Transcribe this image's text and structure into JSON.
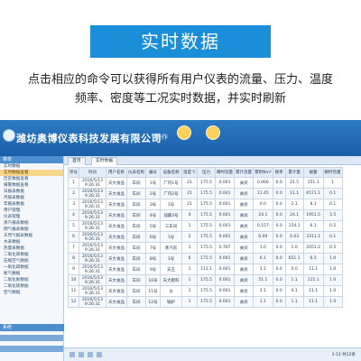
{
  "banner": {
    "title": "实时数据"
  },
  "description": {
    "line1": "点击相应的命令可以获得所有用户仪表的流量、压力、温度",
    "line2": "频率、密度等工况实时数据，并实时刷新"
  },
  "app": {
    "company": "潍坊奥博仪表科技发展有限公司",
    "header_label": "操作"
  },
  "sidebar": {
    "title": "菜单",
    "items": [
      {
        "label": "实时数据",
        "selected": false
      },
      {
        "label": "实时数据查看",
        "selected": true
      },
      {
        "label": "历史数据查看",
        "selected": false
      },
      {
        "label": "报警数据查看",
        "selected": false
      },
      {
        "label": "日报表数据",
        "selected": false
      },
      {
        "label": "月报表数据",
        "selected": false
      },
      {
        "label": "年报表数据",
        "selected": false
      },
      {
        "label": "用户管理",
        "selected": false
      },
      {
        "label": "仪表管理",
        "selected": false
      },
      {
        "label": "蒸汽报表数据",
        "selected": false
      },
      {
        "label": "燃气报表数据",
        "selected": false
      },
      {
        "label": "天然气报表数据",
        "selected": false
      },
      {
        "label": "水表数据",
        "selected": false
      },
      {
        "label": "热量表数据",
        "selected": false
      },
      {
        "label": "二氧化碳数据",
        "selected": false
      },
      {
        "label": "压缩空气数据",
        "selected": false
      },
      {
        "label": "一氧化碳数据",
        "selected": false
      },
      {
        "label": "氮气数据",
        "selected": false
      },
      {
        "label": "二氧化氮数据",
        "selected": false
      },
      {
        "label": "二氧化硫数据",
        "selected": false
      },
      {
        "label": "空气数据",
        "selected": false
      }
    ],
    "footer": "系统"
  },
  "tabs": [
    {
      "label": "首页"
    },
    {
      "label": "实时数据"
    }
  ],
  "table": {
    "headers": [
      "序号",
      "时间",
      "用户名称",
      "仪表名称",
      "编号",
      "设备名称",
      "温度℃",
      "压力",
      "瞬时流量",
      "累计流量",
      "累积Nm³",
      "频率",
      "累计量",
      "报警",
      "瞬时热量",
      "瞬时热量"
    ],
    "rows": [
      [
        "1",
        "2016/5/13 9:26:31",
        "天大食品",
        "车间",
        "1号",
        "厂内1号",
        "21",
        "175.5",
        "0.001",
        "关闭",
        "0.066",
        "0.0",
        "21.5",
        "151.1",
        "1"
      ],
      [
        "2",
        "2016/5/13 9:26:31",
        "天大食品",
        "车间",
        "2号",
        "厂内2号",
        "21",
        "175.5",
        "0.001",
        "关闭",
        "11.45",
        "0.0",
        "11.1",
        "6571.1",
        "0.1"
      ],
      [
        "3",
        "2016/5/13 9:26:31",
        "天大食品",
        "车间",
        "3号",
        "1号",
        "21",
        "175.5",
        "0.001",
        "关闭",
        "0.0",
        "0.0",
        "2.1",
        "8.1",
        "0.1"
      ],
      [
        "4",
        "2016/5/13 9:26:31",
        "天大食品",
        "车间",
        "4号",
        "加藤3号",
        "4",
        "175.5",
        "0.001",
        "关闭",
        "24.1",
        "0.0",
        "24.1",
        "1951.5",
        "3.5"
      ],
      [
        "5",
        "2016/5/13 9:26:31",
        "天大食品",
        "车间",
        "5号",
        "三车间",
        "1",
        "175.5",
        "0.001",
        "关闭",
        "0.157",
        "0.0",
        "154.1",
        "6.1",
        "0.5"
      ],
      [
        "6",
        "2016/5/13 9:26:31",
        "天大食品",
        "车间",
        "6号",
        "1号",
        "2",
        "175.5",
        "0.001",
        "关闭",
        "0.09",
        "0.0",
        "0.03",
        "3311.1",
        "0.1"
      ],
      [
        "7",
        "2016/5/13 9:26:31",
        "天大食品",
        "车间",
        "7号",
        "蒸汽房",
        "1",
        "175.5",
        "0.767",
        "关闭",
        "1.0",
        "0.0",
        "1.0",
        "2051.2",
        "0.5"
      ],
      [
        "8",
        "2016/5/13 9:26:31",
        "天大食品",
        "车间",
        "8号",
        "1号",
        "6",
        "175.5",
        "0.001",
        "关闭",
        "6.1",
        "0.0",
        "651.1",
        "6.5",
        "1.0"
      ],
      [
        "9",
        "2016/5/13 9:26:31",
        "天大食品",
        "车间",
        "9号",
        "天王",
        "1",
        "111.1",
        "0.001",
        "关闭",
        "1.1",
        "0.0",
        "0.0",
        "11.1",
        "1.0"
      ],
      [
        "10",
        "2016/5/13 9:26:31",
        "天大食品",
        "车间",
        "10号",
        "天大肥料",
        "1",
        "175.5",
        "0.001",
        "关闭",
        "51.1",
        "0.0",
        "1.1",
        "115.1",
        "1.0"
      ],
      [
        "11",
        "2016/5/13 9:26:31",
        "天大食品",
        "车间",
        "11号",
        "分",
        "1",
        "175.5",
        "0.001",
        "关闭",
        "1.1",
        "0.0",
        "4.1",
        "11.1",
        "1.0"
      ],
      [
        "12",
        "2016/5/13 9:26:31",
        "天大食品",
        "车间",
        "12号",
        "锅炉",
        "1",
        "175.5",
        "0.001",
        "关闭",
        "1.1",
        "0.0",
        "1.1",
        "11.1",
        "1.0"
      ]
    ]
  },
  "pager": {
    "info": "1-12 共12条"
  },
  "colors": {
    "banner": "#1a8ed8",
    "header": "#1a5fa8",
    "selected": "#f7d58c"
  }
}
